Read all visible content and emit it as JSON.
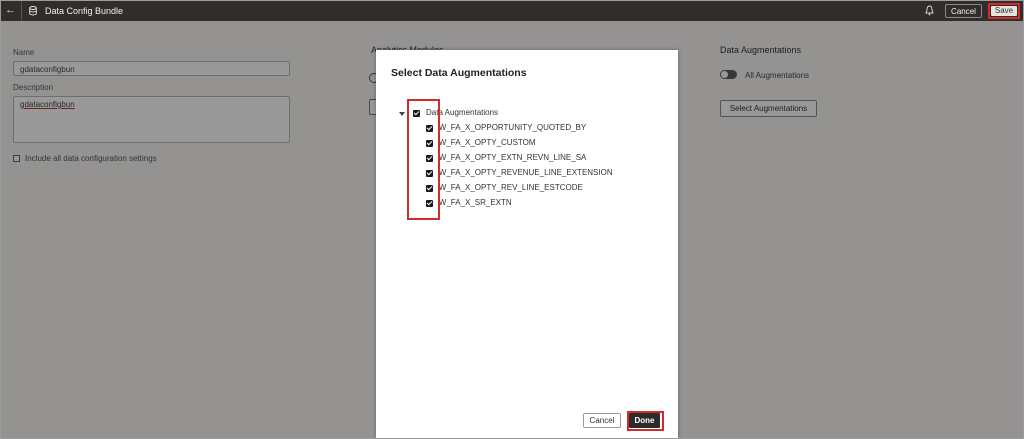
{
  "header": {
    "title": "Data Config Bundle",
    "cancel_label": "Cancel",
    "save_label": "Save"
  },
  "form": {
    "name_label": "Name",
    "name_value": "gdataconfigbun",
    "description_label": "Description",
    "description_value": "gdataconfigbun",
    "include_all_label": "Include all data configuration settings"
  },
  "middle": {
    "heading_partial": "Analytics Modules"
  },
  "right": {
    "heading": "Data Augmentations",
    "toggle_label": "All Augmentations",
    "select_button": "Select Augmentations"
  },
  "modal": {
    "title": "Select Data Augmentations",
    "root_label": "Data Augmentations",
    "items": [
      {
        "label": "DW_FA_X_OPPORTUNITY_QUOTED_BY"
      },
      {
        "label": "DW_FA_X_OPTY_CUSTOM"
      },
      {
        "label": "DW_FA_X_OPTY_EXTN_REVN_LINE_SA"
      },
      {
        "label": "DW_FA_X_OPTY_REVENUE_LINE_EXTENSION"
      },
      {
        "label": "DW_FA_X_OPTY_REV_LINE_ESTCODE"
      },
      {
        "label": "DW_FA_X_SR_EXTN"
      }
    ],
    "cancel_label": "Cancel",
    "done_label": "Done"
  },
  "icons": {
    "back": "back-arrow-icon",
    "database": "database-icon",
    "notification": "bell-icon"
  },
  "colors": {
    "topbar": "#312d2a",
    "highlight": "#d42a2a",
    "done_button": "#2b2b2b"
  }
}
